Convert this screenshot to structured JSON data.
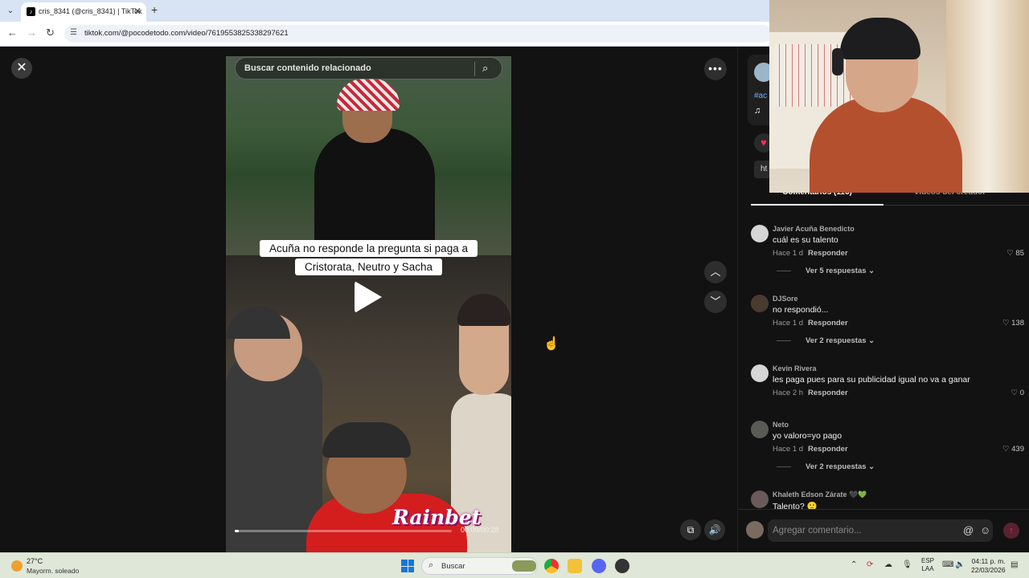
{
  "browser": {
    "tab_title": "cris_8341 (@cris_8341) | TikTok",
    "url": "tiktok.com/@pocodetodo.com/video/7619553825338297621",
    "icons": {
      "back": "arrow-left-icon",
      "forward": "arrow-right-icon",
      "reload": "reload-icon",
      "site_info": "tune-icon",
      "new_tab": "plus-icon"
    }
  },
  "player": {
    "search_placeholder": "Buscar contenido relacionado",
    "caption_line1": "Acuña no responde la pregunta si paga a",
    "caption_line2": "Cristorata, Neutro y Sacha",
    "brand_overlay": "Rainbet",
    "time": "00:00/00:28",
    "progress": 0.02
  },
  "sidebar": {
    "hashtag": "#ac",
    "link_text": "ht",
    "tabs": {
      "comments": "Comentarios (116)",
      "videos": "Videos del creador"
    },
    "comments": [
      {
        "user": "Javier Acuña Benedicto",
        "text": "cuál es su talento",
        "time": "Hace 1 d",
        "reply": "Responder",
        "likes": "85",
        "replies": "Ver 5 respuestas",
        "avatar_color": "#d6d6d6"
      },
      {
        "user": "DJSore",
        "text": "no respondió...",
        "time": "Hace 1 d",
        "reply": "Responder",
        "likes": "138",
        "replies": "Ver 2 respuestas",
        "avatar_color": "#4a3a30"
      },
      {
        "user": "Kevin Rivera",
        "text": "les paga pues para su publicidad igual no va a ganar",
        "time": "Hace 2 h",
        "reply": "Responder",
        "likes": "0",
        "replies": "",
        "avatar_color": "#d6d6d6"
      },
      {
        "user": "Neto",
        "text": "yo valoro=yo pago",
        "time": "Hace 1 d",
        "reply": "Responder",
        "likes": "439",
        "replies": "Ver 2 respuestas",
        "avatar_color": "#5a5a55"
      },
      {
        "user": "Khaleth Edson Zárate 🖤💚",
        "text": "Talento? 🙁",
        "time": "",
        "reply": "",
        "likes": "",
        "replies": "",
        "avatar_color": "#6a5a5a"
      }
    ],
    "comment_placeholder": "Agregar comentario..."
  },
  "taskbar": {
    "temperature": "27°C",
    "weather": "Mayorm. soleado",
    "search": "Buscar",
    "lang_line1": "ESP",
    "lang_line2": "LAA",
    "time": "04:11 p. m.",
    "date": "22/03/2026"
  },
  "colors": {
    "accent": "#fe2c55",
    "link": "#6ab2ff",
    "background": "#121212"
  }
}
